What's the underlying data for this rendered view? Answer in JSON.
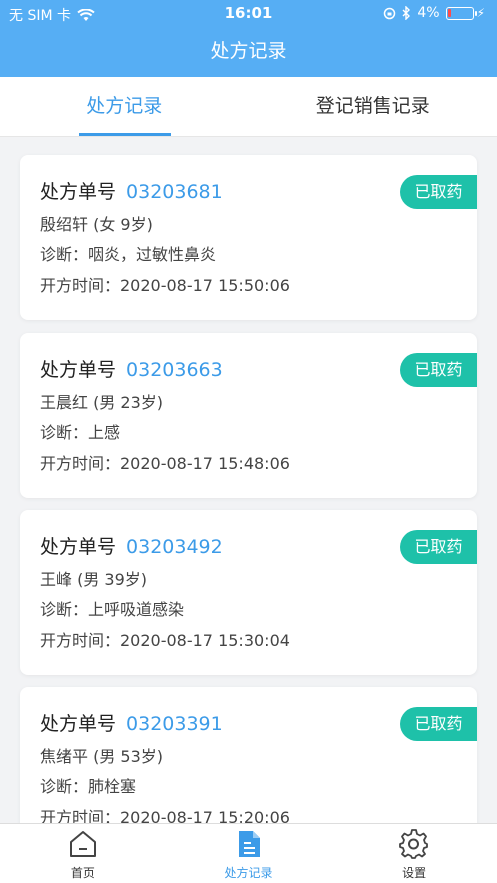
{
  "status_bar": {
    "carrier": "无 SIM 卡",
    "time": "16:01",
    "battery": "4%"
  },
  "header": {
    "title": "处方记录"
  },
  "tabs": [
    {
      "label": "处方记录",
      "active": true
    },
    {
      "label": "登记销售记录",
      "active": false
    }
  ],
  "records": [
    {
      "no_label": "处方单号",
      "no": "03203681",
      "patient": "殷绍轩 (女 9岁)",
      "diagnosis": "诊断：咽炎，过敏性鼻炎",
      "time": "开方时间：2020-08-17 15:50:06",
      "status": "已取药"
    },
    {
      "no_label": "处方单号",
      "no": "03203663",
      "patient": "王晨红 (男 23岁)",
      "diagnosis": "诊断：上感",
      "time": "开方时间：2020-08-17 15:48:06",
      "status": "已取药"
    },
    {
      "no_label": "处方单号",
      "no": "03203492",
      "patient": "王峰 (男 39岁)",
      "diagnosis": "诊断：上呼吸道感染",
      "time": "开方时间：2020-08-17 15:30:04",
      "status": "已取药"
    },
    {
      "no_label": "处方单号",
      "no": "03203391",
      "patient": "焦绪平 (男 53岁)",
      "diagnosis": "诊断：肺栓塞",
      "time": "开方时间：2020-08-17 15:20:06",
      "status": "已取药"
    }
  ],
  "bottom_nav": [
    {
      "label": "首页",
      "icon": "home-icon",
      "active": false
    },
    {
      "label": "处方记录",
      "icon": "document-icon",
      "active": true
    },
    {
      "label": "设置",
      "icon": "gear-icon",
      "active": false
    }
  ],
  "colors": {
    "primary": "#56aef4",
    "accent": "#3c9be8",
    "badge": "#1ec1a9"
  }
}
